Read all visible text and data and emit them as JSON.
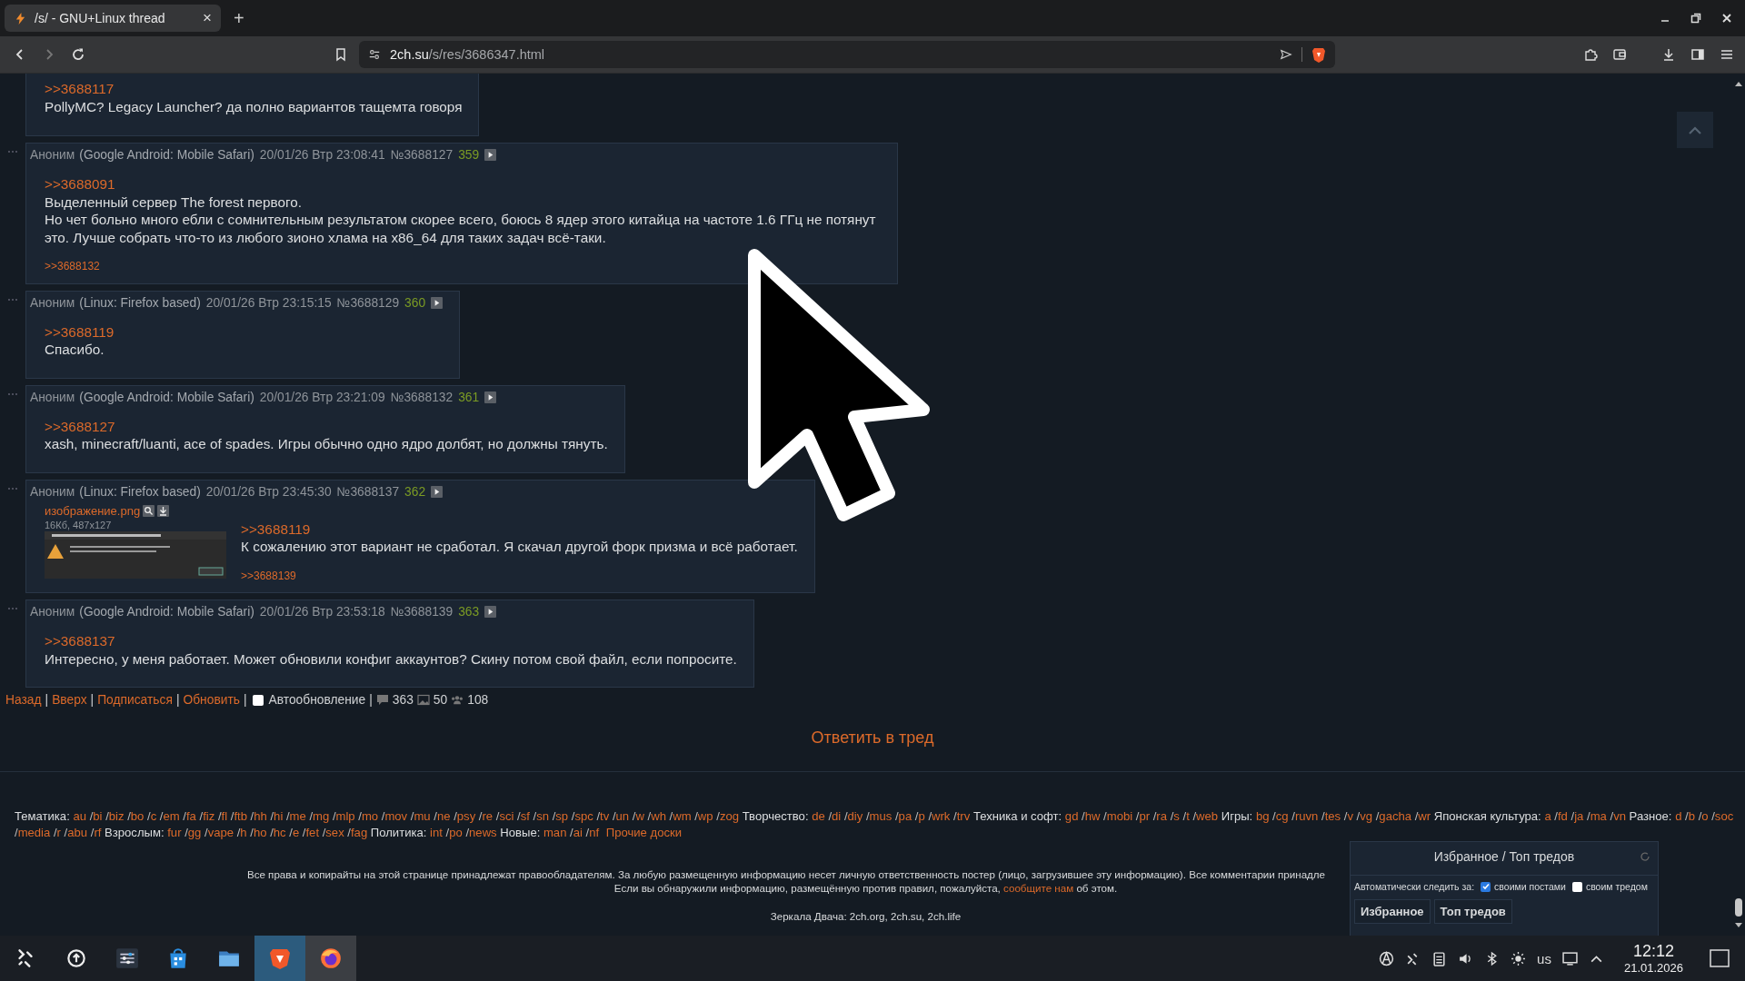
{
  "browser": {
    "tab": {
      "title": "/s/ - GNU+Linux thread",
      "close": "×"
    },
    "new_tab": "+",
    "address": {
      "host": "2ch.su",
      "path": "/s/res/3686347.html"
    }
  },
  "posts": [
    {
      "kind": "partial",
      "reply_to": ">>3688117",
      "lines": [
        "PollyMC? Legacy Launcher? да полно вариантов тащемта говоря"
      ]
    },
    {
      "kind": "full",
      "author": "Аноним",
      "agent": "(Google Android: Mobile Safari)",
      "date": "20/01/26 Втр 23:08:41",
      "number": "№3688127",
      "count": "359",
      "reply_to": ">>3688091",
      "lines": [
        "Выделенный сервер The forest первого.",
        "Но чет больно много ебли с сомнительным результатом скорее всего, боюсь 8 ядер этого китайца на частоте 1.6 ГГц не потянут это. Лучше собрать что-то из любого зионо хлама на x86_64 для таких задач всё-таки."
      ],
      "replies": [
        ">>3688132"
      ]
    },
    {
      "kind": "full",
      "author": "Аноним",
      "agent": "(Linux: Firefox based)",
      "date": "20/01/26 Втр 23:15:15",
      "number": "№3688129",
      "count": "360",
      "reply_to": ">>3688119",
      "lines": [
        "Спасибо."
      ]
    },
    {
      "kind": "full",
      "author": "Аноним",
      "agent": "(Google Android: Mobile Safari)",
      "date": "20/01/26 Втр 23:21:09",
      "number": "№3688132",
      "count": "361",
      "reply_to": ">>3688127",
      "lines": [
        "xash, minecraft/luanti, ace of spades. Игры обычно одно ядро долбят, но должны тянуть."
      ]
    },
    {
      "kind": "full",
      "author": "Аноним",
      "agent": "(Linux: Firefox based)",
      "date": "20/01/26 Втр 23:45:30",
      "number": "№3688137",
      "count": "362",
      "file": {
        "name": "изображение.png",
        "size": "16Кб, 487x127"
      },
      "reply_to": ">>3688119",
      "lines": [
        "К сожалению этот вариант не сработал. Я скачал другой форк призма и всё работает."
      ],
      "replies": [
        ">>3688139"
      ]
    },
    {
      "kind": "full",
      "author": "Аноним",
      "agent": "(Google Android: Mobile Safari)",
      "date": "20/01/26 Втр 23:53:18",
      "number": "№3688139",
      "count": "363",
      "reply_to": ">>3688137",
      "lines": [
        "Интересно, у меня работает. Может обновили конфиг аккаунтов? Скину потом свой файл, если попросите."
      ]
    }
  ],
  "thread_footer": {
    "separator": "|",
    "links": [
      "Назад",
      "Вверх",
      "Подписаться",
      "Обновить"
    ],
    "autoupdate": {
      "label": "Автообновление",
      "checked": false
    },
    "stats": {
      "posts": "363",
      "images": "50",
      "posters": "108"
    }
  },
  "reply_button": "Ответить в тред",
  "boards": {
    "separator": "/",
    "categories": [
      {
        "label": "Тематика:",
        "boards": [
          "au",
          "bi",
          "biz",
          "bo",
          "c",
          "em",
          "fa",
          "fiz",
          "fl",
          "ftb",
          "hh",
          "hi",
          "me",
          "mg",
          "mlp",
          "mo",
          "mov",
          "mu",
          "ne",
          "psy",
          "re",
          "sci",
          "sf",
          "sn",
          "sp",
          "spc",
          "tv",
          "un",
          "w",
          "wh",
          "wm",
          "wp",
          "zog"
        ]
      },
      {
        "label": "Творчество:",
        "boards": [
          "de",
          "di",
          "diy",
          "mus",
          "pa",
          "p",
          "wrk",
          "trv"
        ]
      },
      {
        "label": "Техника и софт:",
        "boards": [
          "gd",
          "hw",
          "mobi",
          "pr",
          "ra",
          "s",
          "t",
          "web"
        ]
      },
      {
        "label": "Игры:",
        "boards": [
          "bg",
          "cg",
          "ruvn",
          "tes",
          "v",
          "vg",
          "gacha",
          "wr"
        ]
      },
      {
        "label": "Японская культура:",
        "boards": [
          "a",
          "fd",
          "ja",
          "ma",
          "vn"
        ]
      },
      {
        "label": "Разное:",
        "boards": [
          "d",
          "b",
          "o",
          "soc",
          "media",
          "r",
          "abu",
          "rf"
        ]
      },
      {
        "label": "Взрослым:",
        "boards": [
          "fur",
          "gg",
          "vape",
          "h",
          "ho",
          "hc",
          "e",
          "fet",
          "sex",
          "fag"
        ]
      },
      {
        "label": "Политика:",
        "boards": [
          "int",
          "po",
          "news"
        ]
      },
      {
        "label": "Новые:",
        "boards": [
          "man",
          "ai",
          "nf"
        ]
      }
    ],
    "other_link": "Прочие доски"
  },
  "copyright": {
    "line1": "Все права и копирайты на этой странице принадлежат правообладателям. За любую размещенную информацию несет личную ответственность постер (лицо, загрузившее эту информацию). Все комментарии принадле",
    "line2_before": "Если вы обнаружили информацию, размещённую против правил, пожалуйста,",
    "link": "сообщите нам",
    "line2_after": "об этом."
  },
  "mirrors": "Зеркала Двача: 2ch.org, 2ch.su, 2ch.life",
  "favorites_panel": {
    "title": "Избранное / Топ тредов",
    "auto_label": "Автоматически следить за:",
    "options": [
      {
        "label": "своими постами",
        "checked": true
      },
      {
        "label": "своим тредом",
        "checked": false
      }
    ],
    "tabs": [
      "Избранное",
      "Топ тредов"
    ]
  },
  "taskbar": {
    "apps": [
      {
        "kind": "launcher",
        "running": false,
        "focused": false
      },
      {
        "kind": "update",
        "running": false,
        "focused": false
      },
      {
        "kind": "settings",
        "running": false,
        "focused": false
      },
      {
        "kind": "store",
        "running": false,
        "focused": false
      },
      {
        "kind": "files",
        "running": false,
        "focused": false
      },
      {
        "kind": "brave",
        "running": true,
        "focused": true
      },
      {
        "kind": "firefox",
        "running": true,
        "focused": false
      }
    ],
    "layout": "us",
    "time": "12:12",
    "date": "21.01.2026"
  }
}
